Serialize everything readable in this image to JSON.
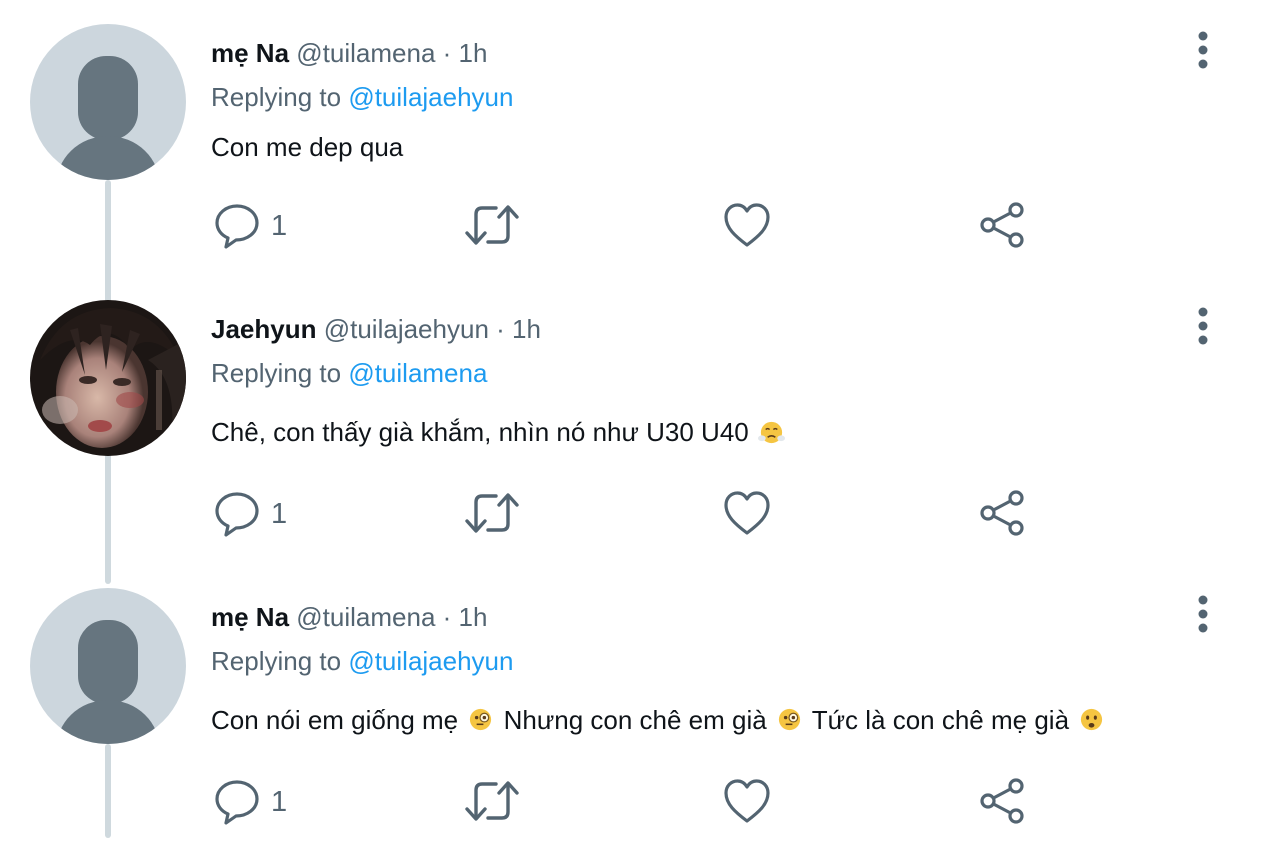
{
  "tweets": [
    {
      "name": "mẹ Na",
      "handle": "@tuilamena",
      "time": "· 1h",
      "replying_label": "Replying to",
      "replying_to": "@tuilajaehyun",
      "avatar": "default-avatar",
      "text_parts": [
        "Con me dep qua"
      ],
      "reply_count": "1"
    },
    {
      "name": "Jaehyun",
      "handle": "@tuilajaehyun",
      "time": "· 1h",
      "replying_label": "Replying to",
      "replying_to": "@tuilamena",
      "avatar": "photo-avatar",
      "text_parts": [
        "Chê, con thấy già khắm, nhìn nó như U30 U40"
      ],
      "emojis": [
        "face-with-steam-emoji"
      ],
      "reply_count": "1"
    },
    {
      "name": "mẹ Na",
      "handle": "@tuilamena",
      "time": "· 1h",
      "replying_label": "Replying to",
      "replying_to": "@tuilajaehyun",
      "avatar": "default-avatar",
      "text_parts": [
        "Con nói em giống mẹ",
        "Nhưng con chê em già",
        "Tức là con chê mẹ già"
      ],
      "emojis": [
        "face-with-monocle-emoji",
        "face-with-monocle-emoji",
        "frowning-face-emoji"
      ],
      "reply_count": "1"
    }
  ],
  "colors": {
    "text": "#0f1419",
    "secondary": "#536471",
    "link": "#1d9bf0",
    "thread_line": "#cfd9de",
    "avatar_bg": "#ccd6dd",
    "avatar_fg": "#66757f"
  },
  "icons": [
    "reply-icon",
    "retweet-icon",
    "like-icon",
    "share-icon",
    "more-options-icon"
  ]
}
